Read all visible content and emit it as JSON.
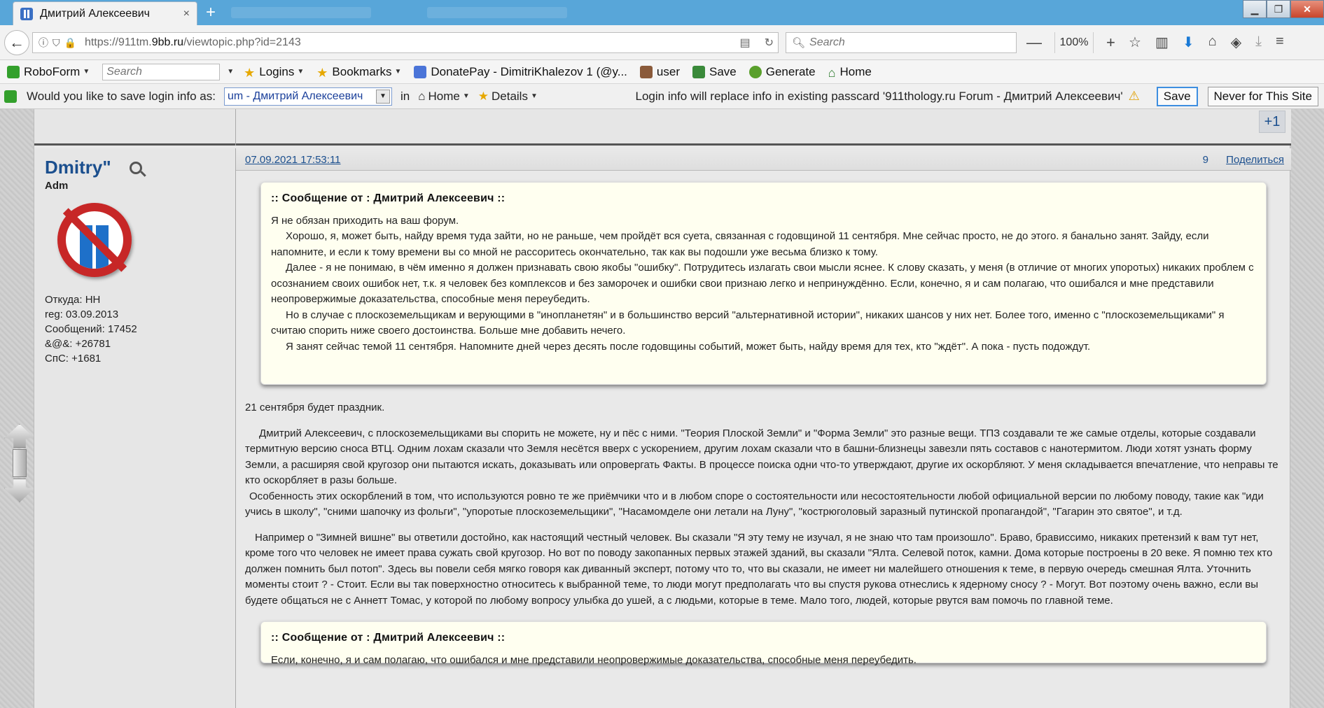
{
  "browser": {
    "tab_title": "Дмитрий Алексеевич",
    "tab_close": "×",
    "new_tab": "+",
    "url_host_prefix": "https://911tm.",
    "url_host_bold": "9bb.ru",
    "url_path": "/viewtopic.php?id=2143",
    "search_placeholder": "Search",
    "zoom_value": "100%",
    "zoom_minus": "—",
    "zoom_plus": "+"
  },
  "bookmarks": {
    "roboform": "RoboForm",
    "roboform_search_placeholder": "Search",
    "logins": "Logins",
    "bookmarks": "Bookmarks",
    "donatepay": "DonatePay - DimitriKhalezov 1 (@y...",
    "user": "user",
    "save": "Save",
    "generate": "Generate",
    "home": "Home"
  },
  "login_bar": {
    "prompt": "Would you like to save login info as:",
    "selected_login": "um - Дмитрий Алексеевич",
    "in_label": "in",
    "home": "Home",
    "details": "Details",
    "message": "Login info will replace info in existing passcard '911thology.ru Forum - Дмитрий Алексеевич'",
    "save_button": "Save",
    "never_button": "Never for This Site"
  },
  "prev_post": {
    "plus_one": "+1"
  },
  "author": {
    "name": "Dmitry\"",
    "rank": "Adm",
    "from": "Откуда: НН",
    "reg": "reg: 03.09.2013",
    "messages": "Сообщений: 17452",
    "rep": "&@&: +26781",
    "thanks": "СпС: +1681"
  },
  "post": {
    "date": "07.09.2021 17:53:11",
    "number": "9",
    "share": "Поделиться",
    "quote1": {
      "title": ":: Сообщение от : Дмитрий Алексеевич ::",
      "lines": [
        "Я не обязан приходить на ваш форум.",
        "Хорошо, я, может быть, найду время туда зайти, но не раньше, чем пройдёт вся суета, связанная с годовщиной 11 сентября. Мне сейчас просто, не до этого. я банально занят. Зайду, если напомните, и если к тому времени вы со мной не рассоритесь окончательно, так как вы подошли уже весьма близко к тому.",
        "Далее - я не понимаю, в чём именно я должен признавать свою якобы \"ошибку\". Потрудитесь излагать свои мысли яснее. К слову сказать, у меня (в отличие от многих упоротых) никаких проблем с осознанием своих ошибок нет, т.к. я человек без комплексов и без заморочек и ошибки свои признаю легко и непринуждённо. Если, конечно, я и сам полагаю, что ошибался и мне представили неопровержимые доказательства, способные меня переубедить.",
        "Но в случае с плоскоземельщикам и верующими в \"инопланетян\" и в большинство версий \"альтернативной истории\", никаких шансов у них нет. Более того, именно с \"плоскоземельщиками\" я считаю спорить ниже своего достоинства. Больше мне добавить нечего.",
        "Я занят сейчас темой 11 сентября. Напомните дней через десять после годовщины событий, может быть, найду время для тех, кто \"ждёт\". А пока - пусть подождут."
      ]
    },
    "para1": "21 сентября будет праздник.",
    "para2": [
      "Дмитрий Алексеевич, с плоскоземельщиками вы спорить не можете, ну и пёс с ними. \"Теория Плоской Земли\" и \"Форма Земли\" это разные вещи. ТПЗ создавали те же самые отделы, которые создавали термитную версию сноса ВТЦ. Одним лохам сказали что Земля несётся вверх с ускорением, другим лохам сказали что в башни-близнецы завезли пять составов с нанотермитом. Люди хотят узнать форму Земли, а расширяя свой кругозор они пытаются искать, доказывать или опровергать Факты. В процессе поиска одни что-то утверждают, другие их оскорбляют. У меня складывается впечатление, что неправы те кто оскорбляет в разы больше.",
      "Особенность этих оскорблений в том, что используются ровно те же приёмчики что и в любом споре о состоятельности или несостоятельности любой официальной версии по любому поводу, такие как \"иди учись в школу\", \"сними шапочку из фольги\", \"упоротые плоскоземельщики\", \"Насамомделе они летали на Луну\", \"кострюголовый заразный путинской пропагандой\", \"Гагарин это святое\", и т.д."
    ],
    "para3": "Например о \"Зимней вишне\" вы ответили достойно, как настоящий честный человек. Вы сказали \"Я эту тему не изучал, я не знаю что там произошло\". Браво, брависсимо, никаких претензий к вам тут нет, кроме того что человек не имеет права сужать свой кругозор. Но вот по поводу закопанных первых этажей зданий, вы сказали \"Ялта. Селевой поток, камни. Дома которые построены в 20 веке. Я помню тех кто должен помнить был потоп\". Здесь вы повели себя мягко говоря как диванный эксперт, потому что то, что вы сказали, не имеет ни малейшего отношения к теме, в первую очередь смешная Ялта. Уточнить моменты стоит ? - Стоит. Если вы так поверхностно относитесь к выбранной теме, то люди могут предполагать что вы спустя рукова отнеслись к ядерному сносу ? - Могут. Вот поэтому очень важно, если вы будете общаться не с Аннетт Томас, у которой по любому вопросу улыбка до ушей, а с людьми, которые в теме. Мало того, людей, которые рвутся вам помочь по главной теме.",
    "quote2": {
      "title": ":: Сообщение от : Дмитрий Алексеевич ::",
      "line": "Если, конечно, я и сам полагаю, что ошибался и мне представили неопровержимые доказательства, способные меня переубедить."
    }
  }
}
